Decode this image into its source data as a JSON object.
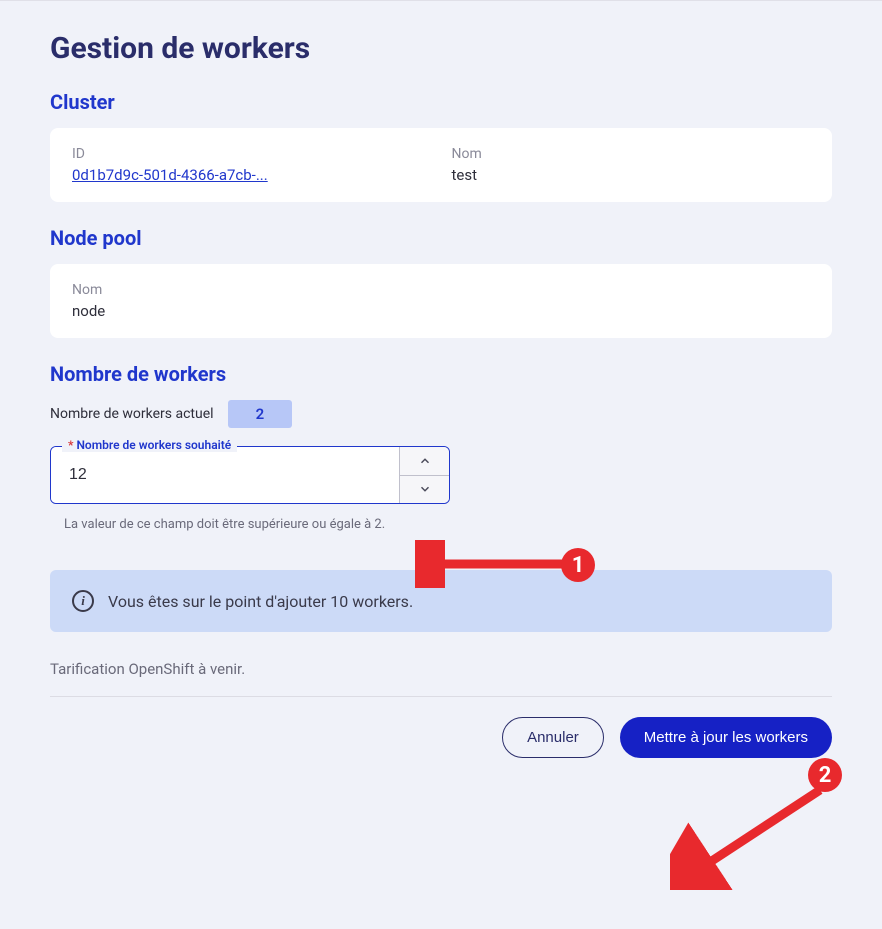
{
  "page": {
    "title": "Gestion de workers"
  },
  "cluster": {
    "section_title": "Cluster",
    "id_label": "ID",
    "id_value": "0d1b7d9c-501d-4366-a7cb-...",
    "name_label": "Nom",
    "name_value": "test"
  },
  "nodepool": {
    "section_title": "Node pool",
    "name_label": "Nom",
    "name_value": "node"
  },
  "workers": {
    "section_title": "Nombre de workers",
    "current_label": "Nombre de workers actuel",
    "current_value": "2",
    "desired_label": "Nombre de workers souhaité",
    "desired_value": "12",
    "helper": "La valeur de ce champ doit être supérieure ou égale à 2."
  },
  "alert": {
    "text": "Vous êtes sur le point d'ajouter 10 workers."
  },
  "pricing_note": "Tarification OpenShift à venir.",
  "actions": {
    "cancel": "Annuler",
    "submit": "Mettre à jour les workers"
  },
  "annotations": {
    "marker1": "1",
    "marker2": "2"
  }
}
